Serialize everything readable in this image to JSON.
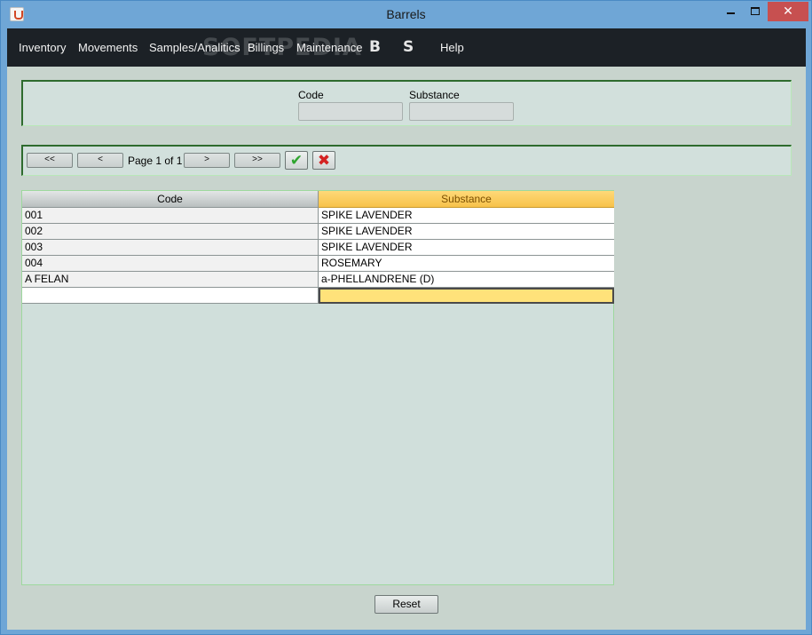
{
  "window": {
    "title": "Barrels"
  },
  "menu": {
    "items": [
      "Inventory",
      "Movements",
      "Samples/Analitics",
      "Billings",
      "Maintenance",
      "Help"
    ],
    "icon_b": "B",
    "icon_s": "S"
  },
  "watermark": "SOFTPEDIA",
  "filter": {
    "code_label": "Code",
    "code_value": "",
    "substance_label": "Substance",
    "substance_value": ""
  },
  "pagination": {
    "first": "<<",
    "prev": "<",
    "page_text": "Page 1 of 1",
    "next": ">",
    "last": ">>",
    "confirm_icon": "✔",
    "cancel_icon": "✖"
  },
  "table": {
    "columns": [
      "Code",
      "Substance"
    ],
    "rows": [
      {
        "code": "001",
        "substance": "SPIKE LAVENDER"
      },
      {
        "code": "002",
        "substance": "SPIKE LAVENDER"
      },
      {
        "code": "003",
        "substance": "SPIKE LAVENDER"
      },
      {
        "code": "004",
        "substance": "ROSEMARY"
      },
      {
        "code": "A FELAN",
        "substance": "a-PHELLANDRENE (D)"
      },
      {
        "code": "",
        "substance": ""
      }
    ]
  },
  "reset_label": "Reset",
  "colors": {
    "titlebar": "#6fa6d6",
    "menubar": "#1c2126",
    "client": "#c8d4cd",
    "header_highlight": "#f7c24a",
    "editing_cell": "#ffe27a"
  }
}
